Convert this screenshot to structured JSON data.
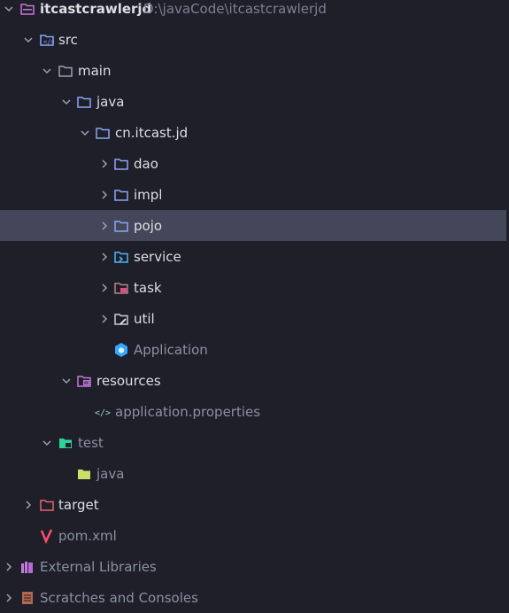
{
  "project": {
    "name": "itcastcrawlerjd",
    "path": "D:\\javaCode\\itcastcrawlerjd"
  },
  "tree": {
    "src": "src",
    "main": "main",
    "java": "java",
    "package": "cn.itcast.jd",
    "dao": "dao",
    "impl": "impl",
    "pojo": "pojo",
    "service": "service",
    "task": "task",
    "util": "util",
    "application": "Application",
    "resources": "resources",
    "application_properties": "application.properties",
    "test": "test",
    "test_java": "java",
    "target": "target",
    "pom": "pom.xml",
    "external_libraries": "External Libraries",
    "scratches": "Scratches and Consoles"
  },
  "colors": {
    "background": "#1e1f29",
    "selected_row": "#434759",
    "folder_blue": "#8aa6f5",
    "resources_purple": "#c678dd",
    "test_green": "#2fd39a",
    "target_red": "#e8646e",
    "maven_pink": "#ff4d6d"
  },
  "selected_item": "pojo"
}
